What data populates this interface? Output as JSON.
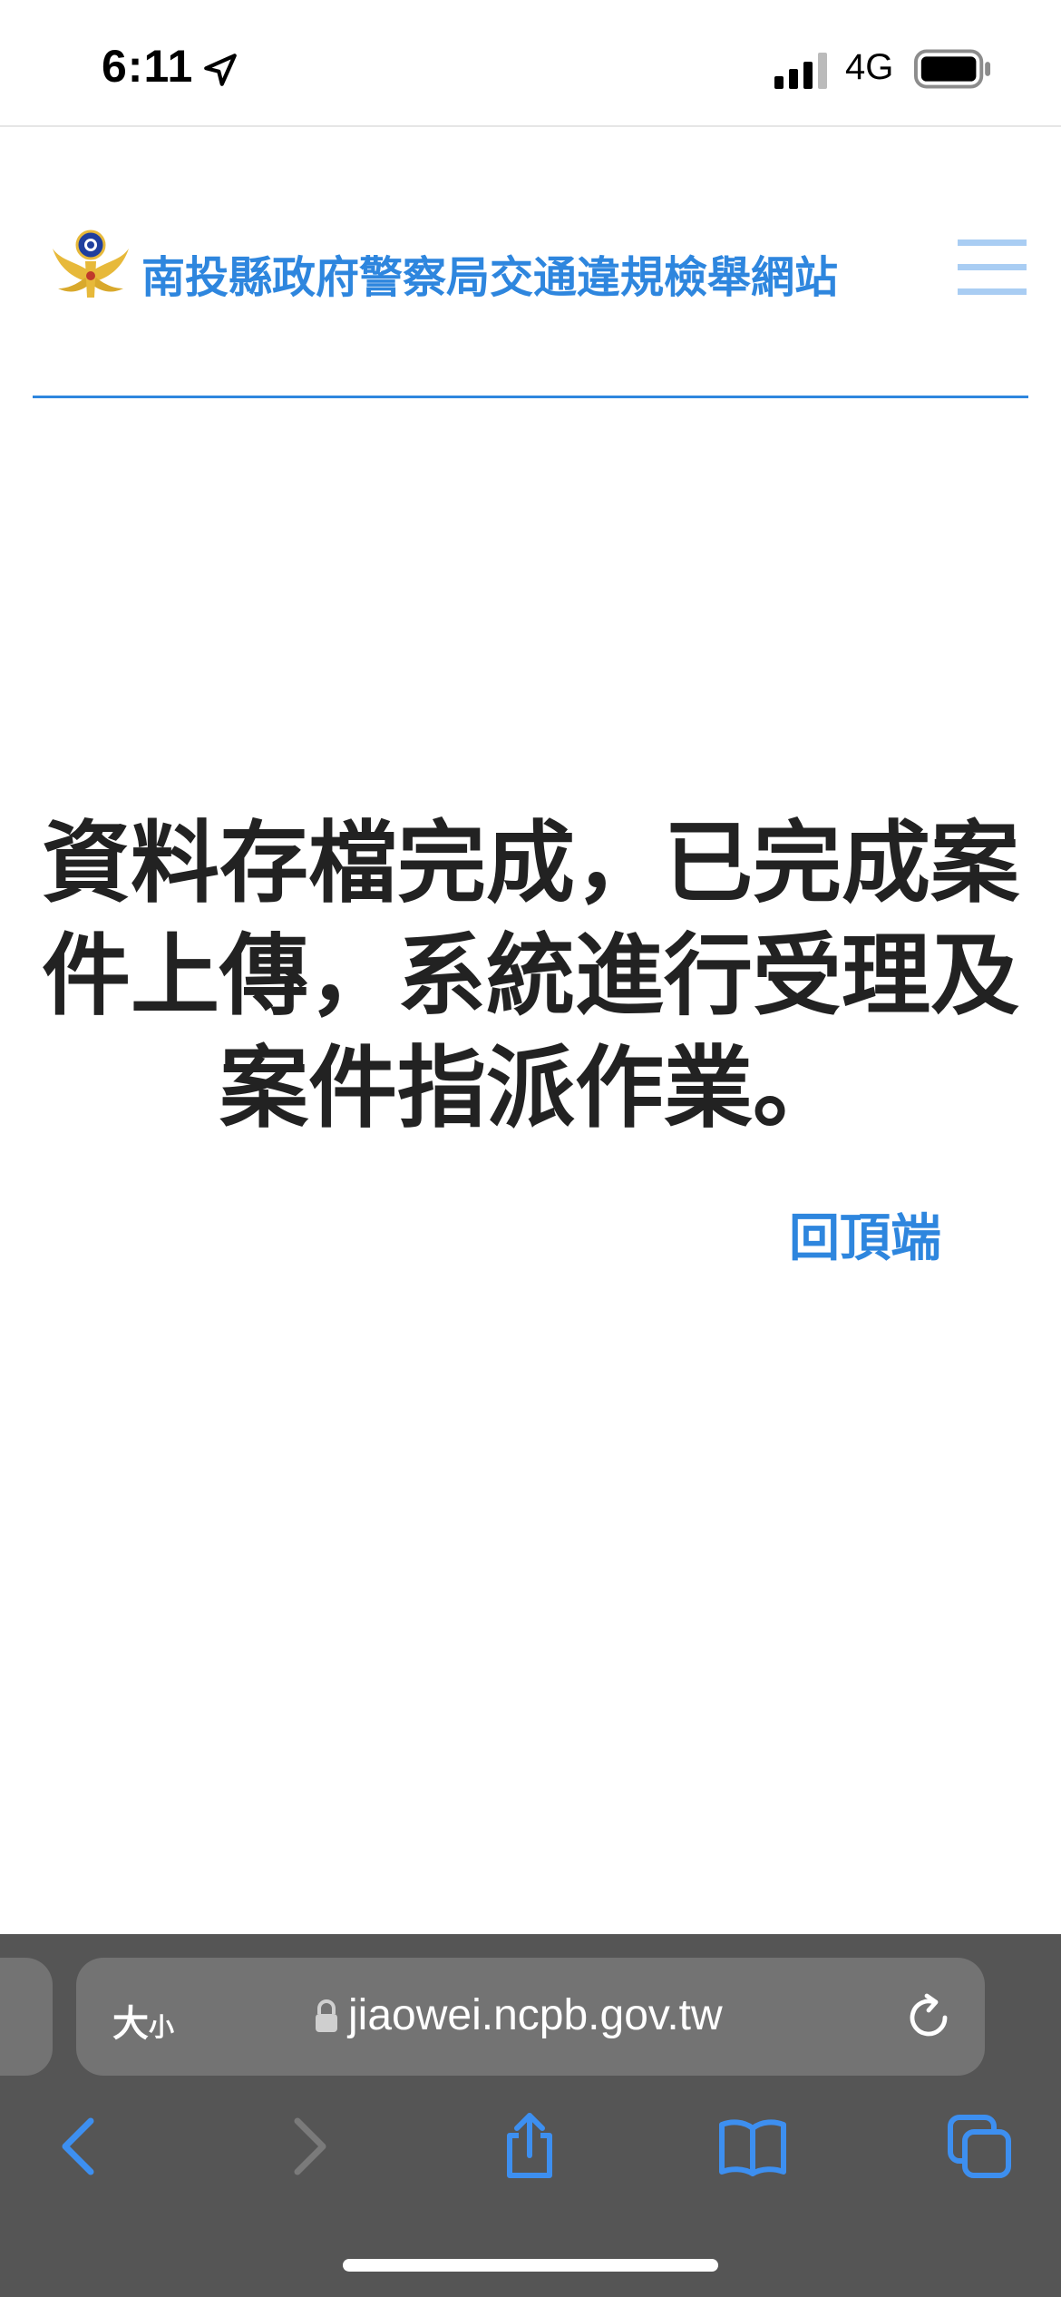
{
  "status_bar": {
    "time": "6:11",
    "network": "4G",
    "icons": [
      "location-arrow-icon",
      "signal-bars-icon",
      "battery-icon"
    ]
  },
  "site": {
    "title": "南投縣政府警察局交通違規檢舉網站",
    "logo_icon": "police-emblem-icon",
    "menu_icon": "hamburger-menu-icon",
    "accent_color": "#2e86de"
  },
  "main": {
    "message_lines": [
      "資料存檔完成，已完成案",
      "件上傳，系統進行受理及",
      "案件指派作業。"
    ],
    "back_to_top": "回頂端"
  },
  "browser": {
    "text_size_large": "大",
    "text_size_small": "小",
    "url": "jiaowei.ncpb.gov.tw",
    "toolbar_icons": [
      "back-arrow-icon",
      "forward-arrow-icon",
      "share-icon",
      "bookmarks-icon",
      "tabs-icon"
    ]
  }
}
